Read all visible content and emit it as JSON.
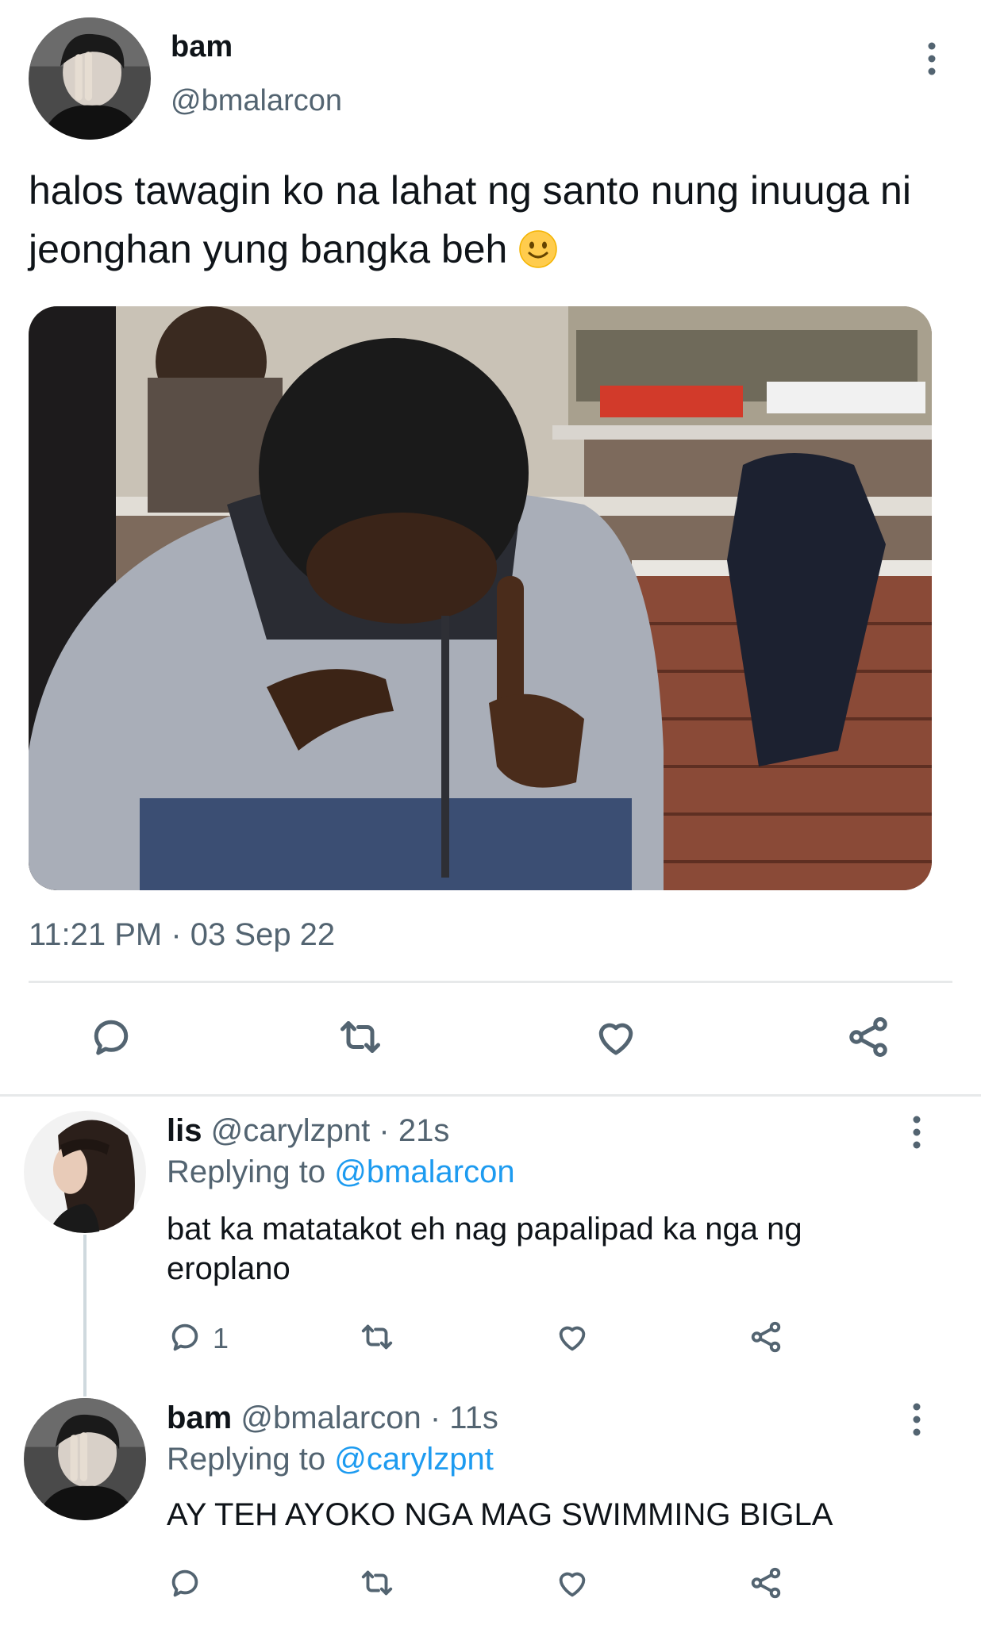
{
  "main_tweet": {
    "display_name": "bam",
    "handle": "@bmalarcon",
    "text": "halos tawagin ko na lahat ng santo nung inuuga ni jeonghan yung bangka beh",
    "emoji": "slightly-smiling-face",
    "media_alt": "photo",
    "timestamp": "11:21 PM · 03 Sep 22",
    "actions": [
      "reply-icon",
      "retweet-icon",
      "like-icon",
      "share-icon"
    ]
  },
  "replies": [
    {
      "display_name": "lis",
      "handle": "@carylzpnt",
      "time": "· 21s",
      "replying_label": "Replying to",
      "replying_to": "@bmalarcon",
      "text": "bat ka matatakot eh nag papalipad ka nga ng eroplano",
      "reply_count": "1"
    },
    {
      "display_name": "bam",
      "handle": "@bmalarcon",
      "time": "· 11s",
      "replying_label": "Replying to",
      "replying_to": "@carylzpnt",
      "text": "AY TEH AYOKO NGA MAG SWIMMING BIGLA",
      "reply_count": ""
    }
  ],
  "colors": {
    "text": "#0f1419",
    "secondary": "#536471",
    "link": "#1d9bf0",
    "divider": "#e7e9ea"
  }
}
